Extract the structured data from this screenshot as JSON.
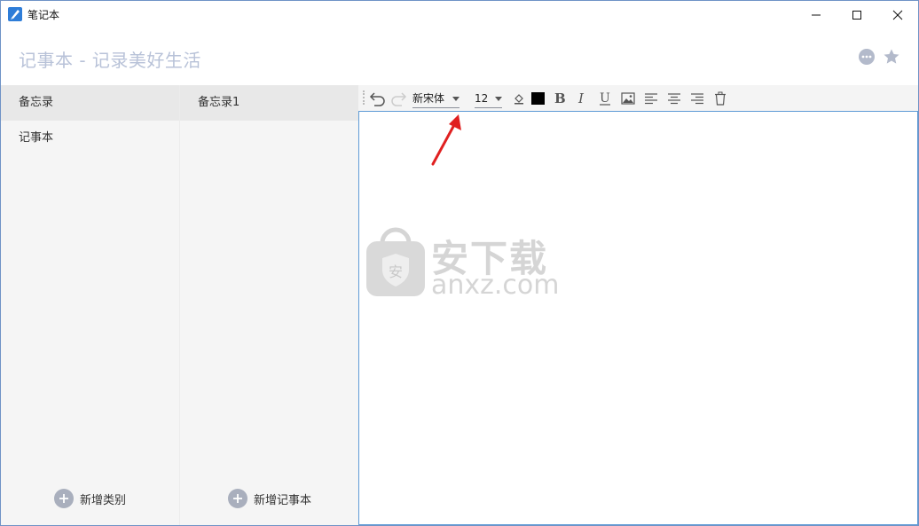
{
  "window": {
    "title": "笔记本",
    "accent_color": "#2e7dd8"
  },
  "header": {
    "heading": "记事本 - 记录美好生活",
    "icons": [
      "more-icon",
      "star-icon"
    ]
  },
  "categories": {
    "header": "备忘录",
    "items": [
      {
        "label": "记事本"
      }
    ],
    "add_label": "新增类别"
  },
  "notes": {
    "header": "备忘录1",
    "items": [],
    "add_label": "新增记事本"
  },
  "toolbar": {
    "font": "新宋体",
    "size": "12",
    "text_color": "#000000",
    "icons": [
      "undo-icon",
      "redo-icon",
      "fill-color-icon",
      "bold-icon",
      "italic-icon",
      "underline-icon",
      "image-icon",
      "align-left-icon",
      "align-center-icon",
      "align-right-icon",
      "delete-icon"
    ]
  },
  "editor": {
    "content": ""
  },
  "watermark": {
    "cn": "安下载",
    "domain": "anxz.com"
  }
}
